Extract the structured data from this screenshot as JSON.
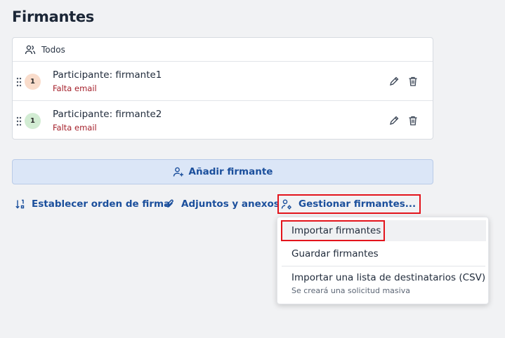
{
  "page": {
    "title": "Firmantes"
  },
  "signers": {
    "filter_label": "Todos",
    "items": [
      {
        "order": "1",
        "name": "Participante: firmante1",
        "warning": "Falta email",
        "badge_color": "#f9dccb"
      },
      {
        "order": "1",
        "name": "Participante: firmante2",
        "warning": "Falta email",
        "badge_color": "#d2ecd3"
      }
    ]
  },
  "actions": {
    "add_signer": "Añadir firmante",
    "set_order": "Establecer orden de firma",
    "attachments": "Adjuntos y anexos",
    "manage": "Gestionar firmantes..."
  },
  "manage_menu": {
    "import": "Importar firmantes",
    "save": "Guardar firmantes",
    "import_csv": "Importar una lista de destinatarios (CSV)",
    "import_csv_note": "Se creará una solicitud masiva"
  },
  "colors": {
    "accent": "#1b4f9c",
    "warning": "#a5202b",
    "highlight": "#e3141c"
  }
}
